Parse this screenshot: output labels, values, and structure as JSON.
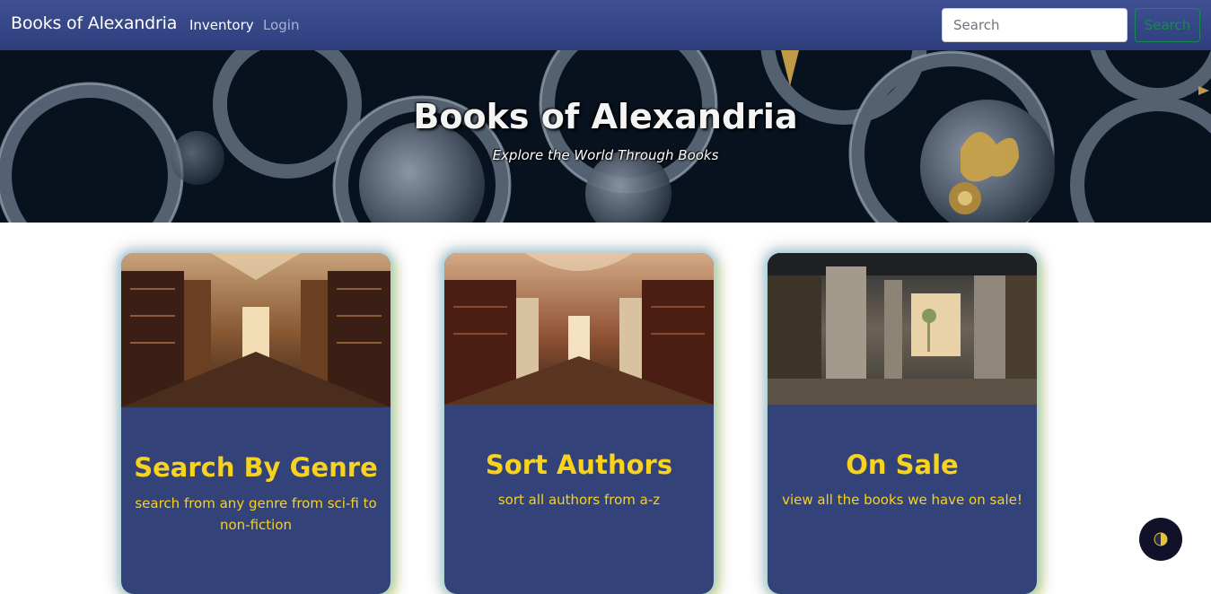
{
  "navbar": {
    "brand": "Books of Alexandria",
    "links": [
      {
        "label": "Inventory"
      },
      {
        "label": "Login"
      }
    ],
    "search": {
      "placeholder": "Search",
      "value": "",
      "button_label": "Search"
    }
  },
  "hero": {
    "title": "Books of Alexandria",
    "subtitle": "Explore the World Through Books"
  },
  "cards": [
    {
      "title": "Search By Genre",
      "text": "search from any genre from sci-fi to non-fiction"
    },
    {
      "title": "Sort Authors",
      "text": "sort all authors from a-z"
    },
    {
      "title": "On Sale",
      "text": "view all the books we have on sale!"
    }
  ],
  "colors": {
    "navbar": "#3a4a8a",
    "card_bg": "#334278",
    "card_text": "#f7d21e",
    "search_button": "#198754"
  },
  "floating_button": {
    "icon": "half-moon-icon"
  }
}
